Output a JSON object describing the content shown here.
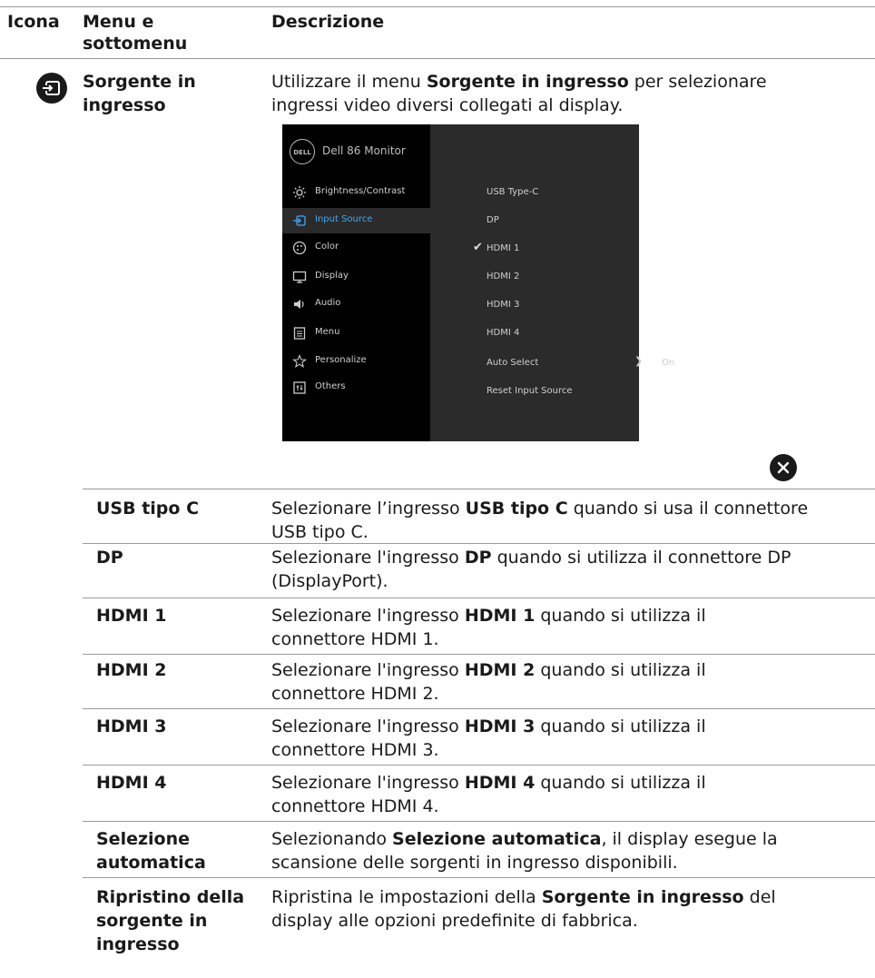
{
  "header": {
    "col_icon": "Icona",
    "col_menu_line1": "Menu e",
    "col_menu_line2": "sottomenu",
    "col_desc": "Descrizione"
  },
  "main_row": {
    "title_line1": "Sorgente in",
    "title_line2": "ingresso",
    "desc_line1_pre": "Utilizzare il menu ",
    "desc_line1_bold": "Sorgente in ingresso",
    "desc_line1_post": " per selezionare",
    "desc_line2": "ingressi video diversi collegati al display."
  },
  "osd": {
    "logo": "DELL",
    "title": "Dell 86 Monitor",
    "menu": [
      {
        "label": "Brightness/Contrast",
        "icon": "brightness-icon"
      },
      {
        "label": "Input Source",
        "icon": "input-source-icon"
      },
      {
        "label": "Color",
        "icon": "color-icon"
      },
      {
        "label": "Display",
        "icon": "display-icon"
      },
      {
        "label": "Audio",
        "icon": "audio-icon"
      },
      {
        "label": "Menu",
        "icon": "menu-icon"
      },
      {
        "label": "Personalize",
        "icon": "star-icon"
      },
      {
        "label": "Others",
        "icon": "others-icon"
      }
    ],
    "options": [
      "USB Type-C",
      "DP",
      "HDMI 1",
      "HDMI 2",
      "HDMI 3",
      "HDMI 4",
      "Auto Select",
      "Reset Input Source"
    ],
    "selected_menu": "Input Source",
    "checked_option": "HDMI 1",
    "auto_select_value": "On",
    "accent_color": "#3fa9f5"
  },
  "rows": [
    {
      "name_lines": [
        "USB tipo C"
      ],
      "l1_pre": "Selezionare l’ingresso ",
      "l1_bold": "USB tipo C",
      "l1_post": " quando si usa il connettore",
      "l2": "USB tipo C."
    },
    {
      "name_lines": [
        "DP"
      ],
      "l1_pre": "Selezionare l'ingresso ",
      "l1_bold": "DP",
      "l1_post": " quando si utilizza il connettore DP",
      "l2": "(DisplayPort)."
    },
    {
      "name_lines": [
        "HDMI 1"
      ],
      "l1_pre": "Selezionare l'ingresso ",
      "l1_bold": "HDMI 1",
      "l1_post": " quando si utilizza il",
      "l2": "connettore HDMI 1."
    },
    {
      "name_lines": [
        "HDMI 2"
      ],
      "l1_pre": "Selezionare l'ingresso ",
      "l1_bold": "HDMI 2",
      "l1_post": " quando si utilizza il",
      "l2": "connettore HDMI 2."
    },
    {
      "name_lines": [
        "HDMI 3"
      ],
      "l1_pre": "Selezionare l'ingresso ",
      "l1_bold": "HDMI 3",
      "l1_post": " quando si utilizza il",
      "l2": "connettore HDMI 3."
    },
    {
      "name_lines": [
        "HDMI 4"
      ],
      "l1_pre": "Selezionare l'ingresso ",
      "l1_bold": "HDMI 4",
      "l1_post": " quando si utilizza il",
      "l2": "connettore HDMI 4."
    },
    {
      "name_lines": [
        "Selezione",
        "automatica"
      ],
      "l1_pre": "Selezionando ",
      "l1_bold": "Selezione automatica",
      "l1_post": ", il display esegue la",
      "l2": "scansione delle sorgenti in ingresso disponibili."
    },
    {
      "name_lines": [
        "Ripristino della",
        "sorgente in",
        "ingresso"
      ],
      "l1_pre": "Ripristina le impostazioni della ",
      "l1_bold": "Sorgente in ingresso",
      "l1_post": " del",
      "l2": "display alle opzioni predefinite di fabbrica."
    }
  ]
}
